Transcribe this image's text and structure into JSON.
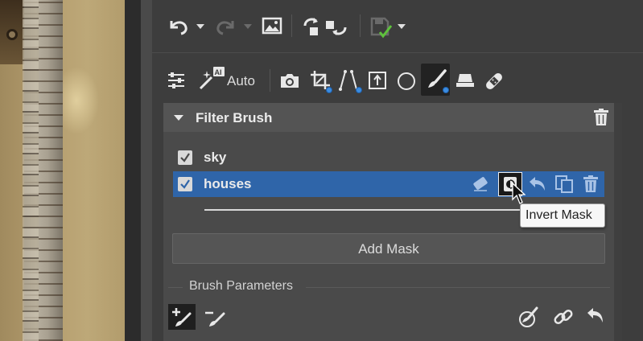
{
  "toolbar": {
    "undo_icon": "undo-icon",
    "redo_icon": "redo-icon",
    "image_icon": "image-icon",
    "compare_icon": "compare-icon",
    "save_icon": "save-icon",
    "auto_label": "Auto"
  },
  "filter_brush": {
    "title": "Filter Brush",
    "masks": [
      {
        "label": "sky",
        "checked": true,
        "selected": false
      },
      {
        "label": "houses",
        "checked": true,
        "selected": true
      }
    ],
    "tooltip": "Invert Mask",
    "add_mask_label": "Add Mask",
    "brush_parameters_label": "Brush Parameters"
  },
  "colors": {
    "accent": "#2f65a9",
    "panel": "#3d3d3d",
    "section": "#4a4a4a",
    "dot": "#3b8ce0",
    "save_check": "#5ec23c"
  }
}
